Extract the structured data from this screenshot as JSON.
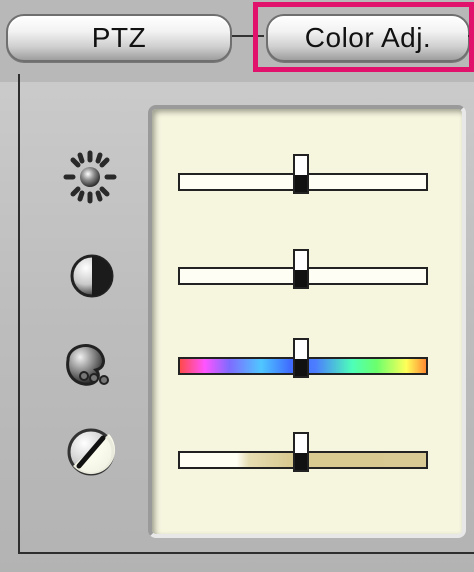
{
  "tabs": [
    {
      "label": "PTZ",
      "selected": false
    },
    {
      "label": "Color Adj.",
      "selected": true
    }
  ],
  "highlight_color": "#e0126b",
  "controls": [
    {
      "name": "brightness",
      "icon": "brightness-icon",
      "value": 0.49
    },
    {
      "name": "contrast",
      "icon": "contrast-icon",
      "value": 0.49
    },
    {
      "name": "hue",
      "icon": "hue-icon",
      "value": 0.49
    },
    {
      "name": "saturation",
      "icon": "saturation-icon",
      "value": 0.49
    }
  ]
}
